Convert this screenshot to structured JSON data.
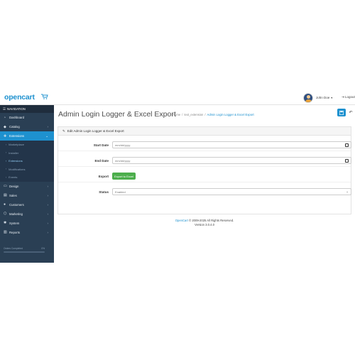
{
  "header": {
    "logo_text": "opencart",
    "user_name": "John Doe",
    "user_caret": "▾",
    "logout_label": "Logout"
  },
  "sidebar": {
    "nav_header": "NAVIGATION",
    "items": [
      {
        "icon": "dashboard-icon",
        "glyph": "◔",
        "label": "Dashboard",
        "chevron": ""
      },
      {
        "icon": "tag-icon",
        "glyph": "◆",
        "label": "Catalog",
        "chevron": "›"
      },
      {
        "icon": "puzzle-icon",
        "glyph": "✚",
        "label": "Extensions",
        "chevron": "⌄",
        "active": true
      },
      {
        "icon": "desktop-icon",
        "glyph": "▭",
        "label": "Design",
        "chevron": "›"
      },
      {
        "icon": "cart-icon",
        "glyph": "▤",
        "label": "Sales",
        "chevron": "›"
      },
      {
        "icon": "user-icon",
        "glyph": "●",
        "label": "Customers",
        "chevron": "›"
      },
      {
        "icon": "share-icon",
        "glyph": "⬡",
        "label": "Marketing",
        "chevron": "›"
      },
      {
        "icon": "gear-icon",
        "glyph": "✱",
        "label": "System",
        "chevron": "›"
      },
      {
        "icon": "chart-icon",
        "glyph": "▥",
        "label": "Reports",
        "chevron": "›"
      }
    ],
    "sub_items": [
      "Marketplace",
      "Installer",
      "Extensions",
      "Modifications",
      "Events"
    ],
    "progress_label": "Orders Completed",
    "progress_value": "0%",
    "progress_fraction": 0
  },
  "page": {
    "title": "Admin Login Logger & Excel Export",
    "breadcrumb": [
      "Home",
      "/",
      "text_extension",
      "/",
      "Admin Login Logger & Excel Export"
    ]
  },
  "panel": {
    "heading": "Edit Admin Login Logger & Excel Export",
    "start_date_label": "Start Date",
    "start_date_placeholder": "mm/dd/yyyy",
    "end_date_label": "End Date",
    "end_date_placeholder": "mm/dd/yyyy",
    "export_label": "Export",
    "export_button": "Export to Excel",
    "status_label": "Status",
    "status_value": "Enabled"
  },
  "footer": {
    "brand": "OpenCart",
    "copyright": "© 2009-2025 All Rights Reserved.",
    "version": "Version 3.0.4.0"
  },
  "colors": {
    "brand_blue": "#1e91cf",
    "sidebar_bg": "#2a3f54",
    "success_green": "#4cae4c"
  }
}
